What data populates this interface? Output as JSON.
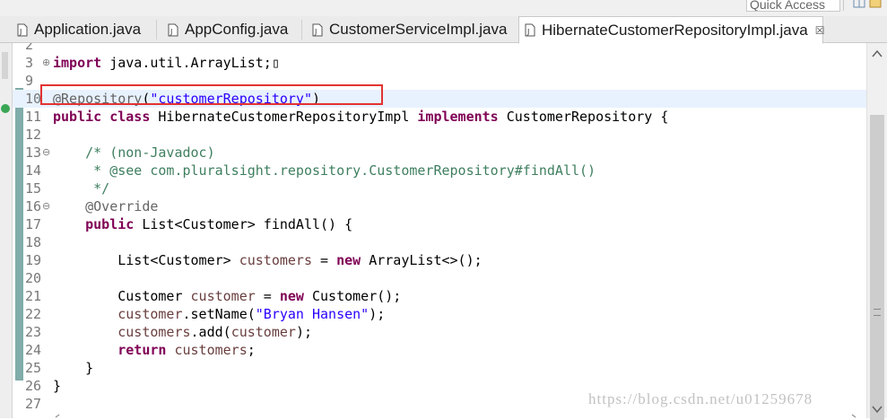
{
  "quick_access": {
    "placeholder": "Quick Access"
  },
  "tabs": [
    {
      "label": "Application.java",
      "active": false,
      "icon": "java-file-icon"
    },
    {
      "label": "AppConfig.java",
      "active": false,
      "icon": "java-file-icon"
    },
    {
      "label": "CustomerServiceImpl.java",
      "active": false,
      "icon": "java-file-icon"
    },
    {
      "label": "HibernateCustomerRepositoryImpl.java",
      "active": true,
      "icon": "java-file-icon",
      "close": "☒"
    }
  ],
  "editor": {
    "lines": [
      {
        "num": "2",
        "segments": []
      },
      {
        "num": "3",
        "fold": "⊕",
        "segments": [
          {
            "t": "import",
            "c": "kw"
          },
          {
            "t": " java.util.ArrayList;",
            "c": ""
          },
          {
            "t": "▯",
            "c": ""
          }
        ]
      },
      {
        "num": "9",
        "segments": []
      },
      {
        "num": "10",
        "current": true,
        "segments": [
          {
            "t": "@Repository",
            "c": "ann"
          },
          {
            "t": "(",
            "c": ""
          },
          {
            "t": "\"customerRepository\"",
            "c": "str"
          },
          {
            "t": ")",
            "c": ""
          }
        ]
      },
      {
        "num": "11",
        "segments": [
          {
            "t": "public",
            "c": "kw"
          },
          {
            "t": " ",
            "c": ""
          },
          {
            "t": "class",
            "c": "kw"
          },
          {
            "t": " HibernateCustomerRepositoryImpl ",
            "c": ""
          },
          {
            "t": "implements",
            "c": "kw"
          },
          {
            "t": " CustomerRepository {",
            "c": ""
          }
        ]
      },
      {
        "num": "12",
        "segments": []
      },
      {
        "num": "13",
        "fold": "⊖",
        "segments": [
          {
            "t": "    /* (non-Javadoc)",
            "c": "cm"
          }
        ]
      },
      {
        "num": "14",
        "segments": [
          {
            "t": "     * @see com.pluralsight.repository.CustomerRepository#findAll()",
            "c": "cm"
          }
        ]
      },
      {
        "num": "15",
        "segments": [
          {
            "t": "     */",
            "c": "cm"
          }
        ]
      },
      {
        "num": "16",
        "fold": "⊖",
        "segments": [
          {
            "t": "    @Override",
            "c": "ann"
          }
        ]
      },
      {
        "num": "17",
        "segments": [
          {
            "t": "    ",
            "c": ""
          },
          {
            "t": "public",
            "c": "kw"
          },
          {
            "t": " List<Customer> findAll() {",
            "c": ""
          }
        ]
      },
      {
        "num": "18",
        "segments": []
      },
      {
        "num": "19",
        "segments": [
          {
            "t": "        List<Customer> ",
            "c": ""
          },
          {
            "t": "customers",
            "c": "fld"
          },
          {
            "t": " = ",
            "c": ""
          },
          {
            "t": "new",
            "c": "kw"
          },
          {
            "t": " ArrayList<>();",
            "c": ""
          }
        ]
      },
      {
        "num": "20",
        "segments": []
      },
      {
        "num": "21",
        "segments": [
          {
            "t": "        Customer ",
            "c": ""
          },
          {
            "t": "customer",
            "c": "fld"
          },
          {
            "t": " = ",
            "c": ""
          },
          {
            "t": "new",
            "c": "kw"
          },
          {
            "t": " Customer();",
            "c": ""
          }
        ]
      },
      {
        "num": "22",
        "segments": [
          {
            "t": "        customer",
            "c": "fld"
          },
          {
            "t": ".setName(",
            "c": ""
          },
          {
            "t": "\"Bryan Hansen\"",
            "c": "str"
          },
          {
            "t": ");",
            "c": ""
          }
        ]
      },
      {
        "num": "23",
        "segments": [
          {
            "t": "        customers",
            "c": "fld"
          },
          {
            "t": ".add(",
            "c": ""
          },
          {
            "t": "customer",
            "c": "fld"
          },
          {
            "t": ");",
            "c": ""
          }
        ]
      },
      {
        "num": "24",
        "segments": [
          {
            "t": "        ",
            "c": ""
          },
          {
            "t": "return",
            "c": "kw"
          },
          {
            "t": " ",
            "c": ""
          },
          {
            "t": "customers",
            "c": "fld"
          },
          {
            "t": ";",
            "c": ""
          }
        ]
      },
      {
        "num": "25",
        "segments": [
          {
            "t": "    }",
            "c": ""
          }
        ]
      },
      {
        "num": "26",
        "segments": [
          {
            "t": "}",
            "c": ""
          }
        ]
      },
      {
        "num": "27",
        "segments": []
      }
    ]
  },
  "watermark": "https://blog.csdn.net/u01259678",
  "colors": {
    "keyword": "#7f0055",
    "string": "#2a00ff",
    "comment": "#3f7f5f",
    "annotation": "#646464",
    "field": "#6a3e3e",
    "highlight_box": "#e33232"
  }
}
